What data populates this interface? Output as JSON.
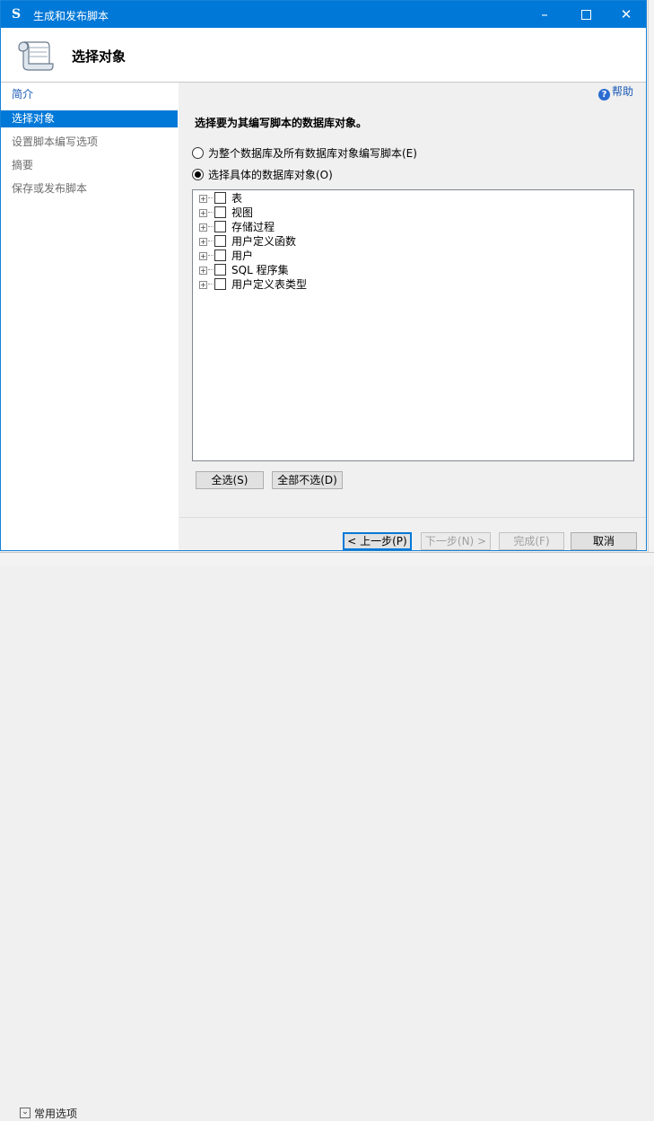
{
  "window": {
    "title": "生成和发布脚本"
  },
  "header": {
    "title": "选择对象"
  },
  "nav": {
    "items": [
      {
        "label": "简介",
        "state": "link"
      },
      {
        "label": "选择对象",
        "state": "selected"
      },
      {
        "label": "设置脚本编写选项",
        "state": "disabled"
      },
      {
        "label": "摘要",
        "state": "disabled"
      },
      {
        "label": "保存或发布脚本",
        "state": "disabled"
      }
    ]
  },
  "main": {
    "help_label": "帮助",
    "instruction": "选择要为其编写脚本的数据库对象。",
    "radio_all": "为整个数据库及所有数据库对象编写脚本(E)",
    "radio_specific": "选择具体的数据库对象(O)",
    "tree_items": [
      "表",
      "视图",
      "存储过程",
      "用户定义函数",
      "用户",
      "SQL 程序集",
      "用户定义表类型"
    ],
    "select_all": "全选(S)",
    "deselect_all": "全部不选(D)"
  },
  "footer": {
    "prev": "< 上一步(P)",
    "next": "下一步(N) >",
    "finish": "完成(F)",
    "cancel": "取消"
  },
  "background": {
    "bottom_text": "常用选项"
  },
  "colors": {
    "accent": "#0078d7",
    "link": "#1a59b5"
  },
  "icons": {
    "title": "script-icon",
    "header": "scroll-icon",
    "help": "help-icon"
  }
}
